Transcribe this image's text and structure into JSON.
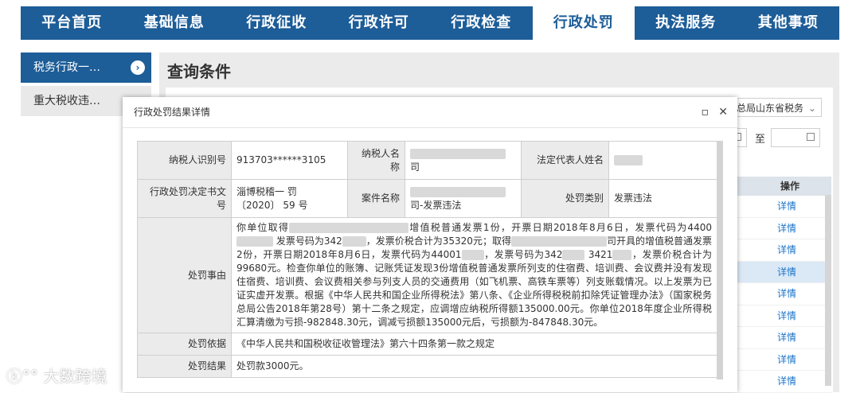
{
  "nav": {
    "items": [
      "平台首页",
      "基础信息",
      "行政征收",
      "行政许可",
      "行政检查",
      "行政处罚",
      "执法服务",
      "其他事项"
    ],
    "active_index": 5
  },
  "sidebar": {
    "items": [
      "税务行政一…",
      "重大税收违…"
    ],
    "active_index": 0
  },
  "query": {
    "title": "查询条件",
    "select_value": "务总局山东省税务",
    "to_label": "至",
    "table_header": "操作",
    "row_link": "详情",
    "row_count": 9,
    "highlighted_row": 3
  },
  "modal": {
    "title": "行政处罚结果详情",
    "taxpayer_id_label": "纳税人识别号",
    "taxpayer_id": "913703******3105",
    "taxpayer_name_label": "纳税人名称",
    "taxpayer_name_suffix": "司",
    "legal_rep_label": "法定代表人姓名",
    "decision_no_label": "行政处罚决定书文号",
    "decision_no": "淄博税稽一 罚 〔2020〕 59 号",
    "case_name_label": "案件名称",
    "case_name_suffix": "司-发票违法",
    "category_label": "处罚类别",
    "category": "发票违法",
    "reason_label": "处罚事由",
    "reason_parts": [
      "你单位取得",
      "增值税普通发票1份，开票日期2018年8月6日，发票代码为4400",
      "发票号码为342",
      "，发票价税合计为35320元；取得",
      "司开具的增值税普通发票2份，开票日期2018年8月6日，发票代码为44001",
      "，发票号码为342",
      "3421",
      "，发票价税合计为99680元。检查你单位的账簿、记账凭证发现3份增值税普通发票所列支的住宿费、培训费、会议费并没有发现住宿费、培训费、会议费相关参与列支人员的交通费用（如飞机票、高铁车票等）列支账载情况。以上发票为已证实虚开发票。根据《中华人民共和国企业所得税法》第八条、《企业所得税税前扣除凭证管理办法》（国家税务总局公告2018年第28号）第十二条之规定，应调增应纳税所得额135000.00元。你单位2018年度企业所得税汇算清缴为亏损-982848.30元，调减亏损额135000元后，亏损额为-847848.30元。"
    ],
    "basis_label": "处罚依据",
    "basis": "《中华人民共和国税收征收管理法》第六十四条第一款之规定",
    "result_label": "处罚结果",
    "result": "处罚款3000元。"
  },
  "watermark": "大数跨境",
  "colors": {
    "nav_bg": "#1d5d98",
    "link": "#1a73c8",
    "label_bg": "#ebebeb"
  }
}
